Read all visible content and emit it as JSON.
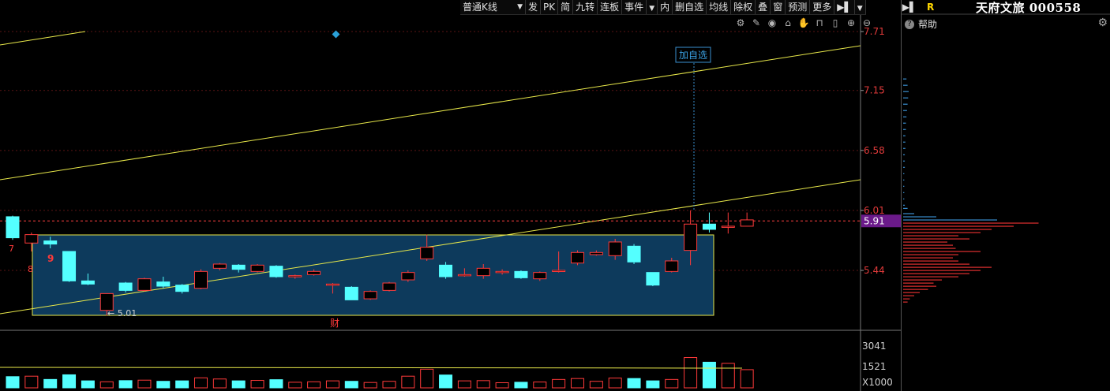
{
  "toolbar": {
    "period": "普通K线",
    "items": [
      "发",
      "PK",
      "简",
      "九转",
      "连板",
      "事件",
      "内",
      "删自选",
      "均线",
      "除权",
      "叠",
      "窗",
      "预测",
      "更多"
    ],
    "collapse_glyph": "▶▌"
  },
  "chart": {
    "y_axis_labels": [
      "7.71",
      "7.15",
      "6.58",
      "6.01",
      "5.44"
    ],
    "current_price": "5.91",
    "low_label": "5.01",
    "add_watchlist_label": "加自选",
    "finance_marker": "财",
    "markers": [
      "7",
      "9",
      "8"
    ],
    "volume_axis_labels": [
      "3041",
      "1521",
      "X1000"
    ],
    "colors": {
      "up": "#ff3a3a",
      "down": "#54ffff",
      "trend": "#e8e84a",
      "box_fill": "#0d3a5c",
      "price_box": "#6b1a8a"
    }
  },
  "candles": [
    {
      "o": 5.95,
      "c": 5.75,
      "h": 5.96,
      "l": 5.73,
      "v": 480
    },
    {
      "o": 5.7,
      "c": 5.78,
      "h": 5.8,
      "l": 5.62,
      "v": 500
    },
    {
      "o": 5.72,
      "c": 5.69,
      "h": 5.76,
      "l": 5.65,
      "v": 360
    },
    {
      "o": 5.62,
      "c": 5.34,
      "h": 5.62,
      "l": 5.33,
      "v": 560
    },
    {
      "o": 5.34,
      "c": 5.31,
      "h": 5.41,
      "l": 5.3,
      "v": 300
    },
    {
      "o": 5.06,
      "c": 5.22,
      "h": 5.22,
      "l": 5.01,
      "v": 260
    },
    {
      "o": 5.32,
      "c": 5.25,
      "h": 5.33,
      "l": 5.23,
      "v": 310
    },
    {
      "o": 5.25,
      "c": 5.36,
      "h": 5.37,
      "l": 5.24,
      "v": 330
    },
    {
      "o": 5.33,
      "c": 5.29,
      "h": 5.38,
      "l": 5.27,
      "v": 280
    },
    {
      "o": 5.3,
      "c": 5.24,
      "h": 5.31,
      "l": 5.22,
      "v": 300
    },
    {
      "o": 5.27,
      "c": 5.43,
      "h": 5.45,
      "l": 5.26,
      "v": 430
    },
    {
      "o": 5.46,
      "c": 5.5,
      "h": 5.51,
      "l": 5.44,
      "v": 380
    },
    {
      "o": 5.49,
      "c": 5.45,
      "h": 5.5,
      "l": 5.42,
      "v": 300
    },
    {
      "o": 5.43,
      "c": 5.49,
      "h": 5.5,
      "l": 5.42,
      "v": 320
    },
    {
      "o": 5.48,
      "c": 5.38,
      "h": 5.49,
      "l": 5.37,
      "v": 350
    },
    {
      "o": 5.38,
      "c": 5.39,
      "h": 5.4,
      "l": 5.36,
      "v": 240
    },
    {
      "o": 5.4,
      "c": 5.43,
      "h": 5.45,
      "l": 5.39,
      "v": 260
    },
    {
      "o": 5.31,
      "c": 5.31,
      "h": 5.32,
      "l": 5.22,
      "v": 300
    },
    {
      "o": 5.28,
      "c": 5.16,
      "h": 5.29,
      "l": 5.16,
      "v": 280
    },
    {
      "o": 5.17,
      "c": 5.24,
      "h": 5.25,
      "l": 5.16,
      "v": 230
    },
    {
      "o": 5.25,
      "c": 5.32,
      "h": 5.33,
      "l": 5.24,
      "v": 280
    },
    {
      "o": 5.35,
      "c": 5.42,
      "h": 5.44,
      "l": 5.33,
      "v": 500
    },
    {
      "o": 5.55,
      "c": 5.66,
      "h": 5.78,
      "l": 5.53,
      "v": 800
    },
    {
      "o": 5.49,
      "c": 5.38,
      "h": 5.52,
      "l": 5.36,
      "v": 550
    },
    {
      "o": 5.39,
      "c": 5.4,
      "h": 5.46,
      "l": 5.38,
      "v": 300
    },
    {
      "o": 5.39,
      "c": 5.46,
      "h": 5.5,
      "l": 5.36,
      "v": 310
    },
    {
      "o": 5.42,
      "c": 5.43,
      "h": 5.45,
      "l": 5.4,
      "v": 220
    },
    {
      "o": 5.43,
      "c": 5.37,
      "h": 5.44,
      "l": 5.36,
      "v": 240
    },
    {
      "o": 5.36,
      "c": 5.42,
      "h": 5.43,
      "l": 5.34,
      "v": 250
    },
    {
      "o": 5.43,
      "c": 5.44,
      "h": 5.62,
      "l": 5.42,
      "v": 360
    },
    {
      "o": 5.51,
      "c": 5.61,
      "h": 5.63,
      "l": 5.49,
      "v": 400
    },
    {
      "o": 5.59,
      "c": 5.61,
      "h": 5.63,
      "l": 5.58,
      "v": 280
    },
    {
      "o": 5.58,
      "c": 5.71,
      "h": 5.74,
      "l": 5.54,
      "v": 420
    },
    {
      "o": 5.67,
      "c": 5.52,
      "h": 5.69,
      "l": 5.5,
      "v": 400
    },
    {
      "o": 5.42,
      "c": 5.3,
      "h": 5.42,
      "l": 5.29,
      "v": 300
    },
    {
      "o": 5.43,
      "c": 5.53,
      "h": 5.56,
      "l": 5.42,
      "v": 360
    },
    {
      "o": 5.63,
      "c": 5.88,
      "h": 6.01,
      "l": 5.49,
      "v": 1300
    },
    {
      "o": 5.88,
      "c": 5.83,
      "h": 5.99,
      "l": 5.8,
      "v": 1100
    },
    {
      "o": 5.86,
      "c": 5.86,
      "h": 5.99,
      "l": 5.79,
      "v": 1050
    },
    {
      "o": 5.86,
      "c": 5.92,
      "h": 5.99,
      "l": 5.86,
      "v": 780
    }
  ],
  "volume_profile": [
    {
      "p": 5.98,
      "w": 20,
      "t": "down"
    },
    {
      "p": 5.95,
      "w": 60,
      "t": "down"
    },
    {
      "p": 5.92,
      "w": 170,
      "t": "down"
    },
    {
      "p": 5.89,
      "w": 245,
      "t": "up"
    },
    {
      "p": 5.86,
      "w": 200,
      "t": "up"
    },
    {
      "p": 5.83,
      "w": 160,
      "t": "up"
    },
    {
      "p": 5.8,
      "w": 140,
      "t": "up"
    },
    {
      "p": 5.77,
      "w": 100,
      "t": "up"
    },
    {
      "p": 5.74,
      "w": 120,
      "t": "up"
    },
    {
      "p": 5.71,
      "w": 80,
      "t": "up"
    },
    {
      "p": 5.68,
      "w": 90,
      "t": "up"
    },
    {
      "p": 5.65,
      "w": 95,
      "t": "up"
    },
    {
      "p": 5.62,
      "w": 140,
      "t": "up"
    },
    {
      "p": 5.59,
      "w": 100,
      "t": "up"
    },
    {
      "p": 5.56,
      "w": 90,
      "t": "up"
    },
    {
      "p": 5.53,
      "w": 100,
      "t": "up"
    },
    {
      "p": 5.5,
      "w": 120,
      "t": "up"
    },
    {
      "p": 5.47,
      "w": 160,
      "t": "up"
    },
    {
      "p": 5.44,
      "w": 140,
      "t": "up"
    },
    {
      "p": 5.41,
      "w": 120,
      "t": "up"
    },
    {
      "p": 5.38,
      "w": 100,
      "t": "up"
    },
    {
      "p": 5.35,
      "w": 70,
      "t": "up"
    },
    {
      "p": 5.32,
      "w": 55,
      "t": "up"
    },
    {
      "p": 5.29,
      "w": 60,
      "t": "up"
    },
    {
      "p": 5.26,
      "w": 45,
      "t": "up"
    },
    {
      "p": 5.23,
      "w": 30,
      "t": "up"
    },
    {
      "p": 5.2,
      "w": 20,
      "t": "up"
    },
    {
      "p": 5.17,
      "w": 12,
      "t": "up"
    },
    {
      "p": 5.14,
      "w": 8,
      "t": "up"
    },
    {
      "p": 7.26,
      "w": 6,
      "t": "down"
    },
    {
      "p": 7.2,
      "w": 8,
      "t": "down"
    },
    {
      "p": 7.14,
      "w": 10,
      "t": "down"
    },
    {
      "p": 7.08,
      "w": 9,
      "t": "down"
    },
    {
      "p": 7.02,
      "w": 8,
      "t": "down"
    },
    {
      "p": 6.96,
      "w": 7,
      "t": "down"
    },
    {
      "p": 6.9,
      "w": 6,
      "t": "down"
    },
    {
      "p": 6.84,
      "w": 5,
      "t": "down"
    },
    {
      "p": 6.78,
      "w": 5,
      "t": "down"
    },
    {
      "p": 6.72,
      "w": 4,
      "t": "down"
    },
    {
      "p": 6.66,
      "w": 4,
      "t": "down"
    },
    {
      "p": 6.6,
      "w": 4,
      "t": "down"
    },
    {
      "p": 6.54,
      "w": 3,
      "t": "down"
    },
    {
      "p": 6.48,
      "w": 3,
      "t": "down"
    },
    {
      "p": 6.42,
      "w": 3,
      "t": "down"
    },
    {
      "p": 6.36,
      "w": 2,
      "t": "down"
    },
    {
      "p": 6.3,
      "w": 2,
      "t": "down"
    },
    {
      "p": 6.24,
      "w": 2,
      "t": "down"
    },
    {
      "p": 6.18,
      "w": 2,
      "t": "down"
    },
    {
      "p": 6.12,
      "w": 2,
      "t": "down"
    },
    {
      "p": 6.06,
      "w": 3,
      "t": "down"
    },
    {
      "p": 6.03,
      "w": 8,
      "t": "down"
    }
  ],
  "right_panel": {
    "collapse_glyph": "▶▌",
    "r_label": "R",
    "stock_name": "天府文旅 000558",
    "help_label": "帮助"
  }
}
